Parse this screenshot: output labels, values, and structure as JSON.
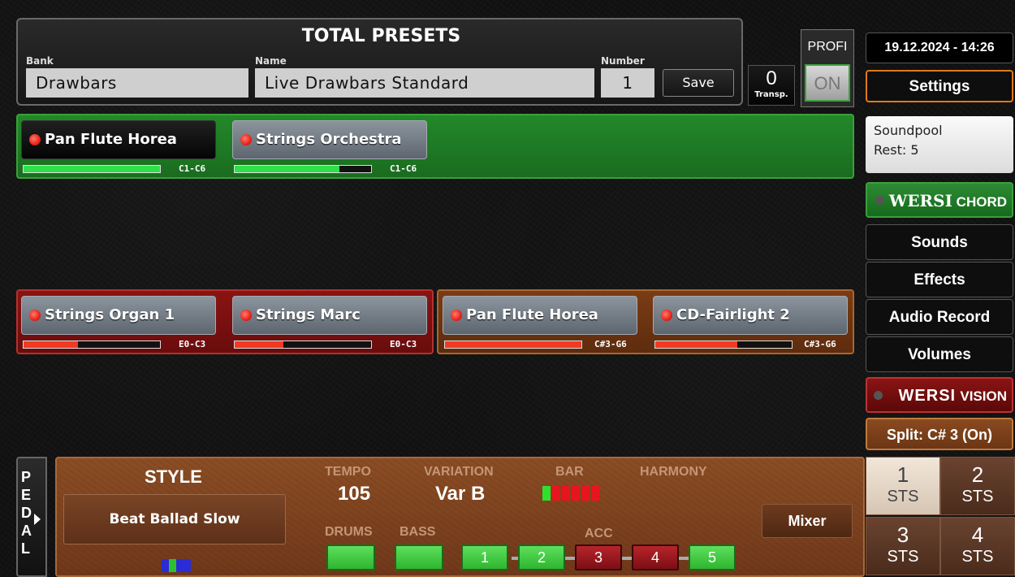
{
  "header": {
    "title": "TOTAL PRESETS",
    "bank_label": "Bank",
    "bank_value": "Drawbars",
    "name_label": "Name",
    "name_value": "Live Drawbars Standard",
    "number_label": "Number",
    "number_value": "1",
    "save_label": "Save",
    "transp_value": "0",
    "transp_label": "Transp.",
    "profi_label": "PROFI",
    "profi_button": "ON"
  },
  "right": {
    "datetime": "19.12.2024 - 14:26",
    "settings": "Settings",
    "soundpool_line1": "Soundpool",
    "soundpool_line2": "Rest: 5",
    "wersi_chord_1": "WERSI",
    "wersi_chord_2": " CHORD",
    "sounds": "Sounds",
    "effects": "Effects",
    "audio_record": "Audio Record",
    "volumes": "Volumes",
    "wersi_vision_1": "WERSI",
    "wersi_vision_2": "VISION",
    "split": "Split: C# 3 (On)"
  },
  "upper": {
    "voices": [
      {
        "name": "Pan Flute Horea",
        "range": "C1-C6",
        "level": 1.0
      },
      {
        "name": "Strings Orchestra",
        "range": "C1-C6",
        "level": 0.77
      }
    ]
  },
  "lower": {
    "voices": [
      {
        "name": "Strings Organ 1",
        "range": "E0-C3",
        "level": 0.4
      },
      {
        "name": "Strings Marc",
        "range": "E0-C3",
        "level": 0.36
      },
      {
        "name": "Pan Flute Horea",
        "range": "C#3-G6",
        "level": 1.0
      },
      {
        "name": "CD-Fairlight 2",
        "range": "C#3-G6",
        "level": 0.6
      }
    ]
  },
  "pedal": {
    "letters": [
      "P",
      "E",
      "D",
      "A",
      "L"
    ]
  },
  "style": {
    "title": "STYLE",
    "name": "Beat Ballad Slow",
    "tempo_label": "TEMPO",
    "tempo_value": "105",
    "variation_label": "VARIATION",
    "variation_value": "Var B",
    "bar_label": "BAR",
    "harmony_label": "HARMONY",
    "drums_label": "DRUMS",
    "bass_label": "BASS",
    "acc_label": "ACC",
    "acc_buttons": [
      "1",
      "2",
      "3",
      "4",
      "5"
    ],
    "mixer": "Mixer"
  },
  "sts": [
    {
      "n": "1",
      "t": "STS"
    },
    {
      "n": "2",
      "t": "STS"
    },
    {
      "n": "3",
      "t": "STS"
    },
    {
      "n": "4",
      "t": "STS"
    }
  ],
  "colors": {
    "upper_bg": "#1f7a23",
    "lower_left_bg": "#7e1010",
    "lower_right_bg": "#6e3512",
    "style_bg": "#7d4420",
    "led_red": "#e8231b"
  }
}
